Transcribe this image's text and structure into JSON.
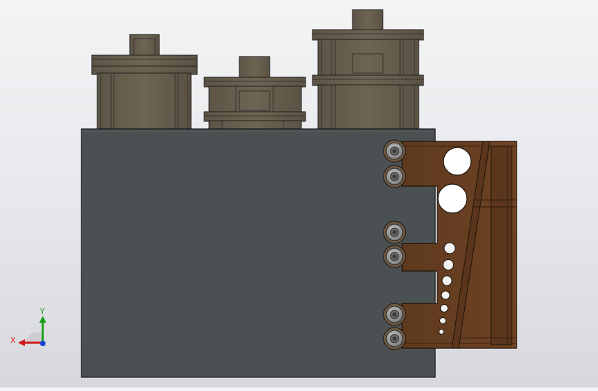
{
  "triad": {
    "x_label": "X",
    "y_label": "Y",
    "x_color": "#d01818",
    "y_color": "#18a018",
    "z_color": "#1840d0"
  },
  "colors": {
    "background_top": "#f4f4f6",
    "background_bottom": "#d6d8dd",
    "block_face": "#4b5153",
    "component_body": "#6b6150",
    "bracket_body": "#6b3f22",
    "fastener": "#8a8a8a"
  },
  "model": {
    "components": [
      "motor-left",
      "motor-center",
      "motor-right",
      "base-block",
      "mounting-bracket"
    ],
    "fastener_count": 6,
    "bracket_hole_count": 9
  }
}
